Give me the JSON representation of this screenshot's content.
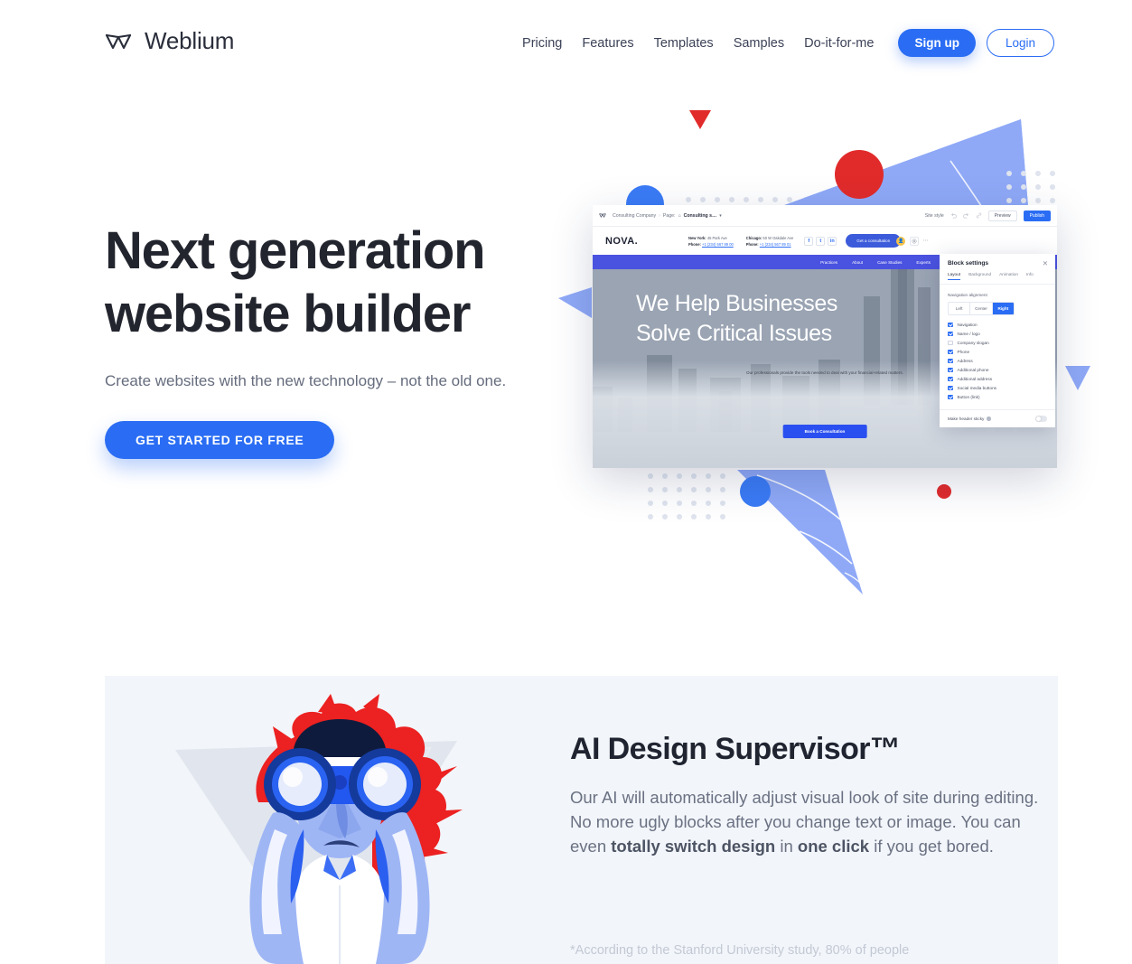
{
  "brand": {
    "name": "Weblium",
    "logo_icon": "weblium-w-logo"
  },
  "nav": {
    "links": [
      "Pricing",
      "Features",
      "Templates",
      "Samples",
      "Do-it-for-me"
    ],
    "signup_label": "Sign up",
    "login_label": "Login"
  },
  "hero": {
    "title_line1": "Next generation",
    "title_line2": "website builder",
    "subtitle": "Create websites with the new technology – not the old one.",
    "cta_label": "GET STARTED FOR FREE"
  },
  "editor": {
    "toolbar": {
      "logo_icon": "weblium-w-logo",
      "crumb_site": "Consulting Company",
      "crumb_sep": "›",
      "crumb_page_label": "Page:",
      "crumb_page_icon": "home-icon",
      "crumb_page_name": "Consulting s…",
      "crumb_caret": "▾",
      "site_style_label": "Site style",
      "undo_icon": "undo-icon",
      "redo_icon": "redo-icon",
      "link_icon": "link-icon",
      "preview_label": "Preview",
      "publish_label": "Publish"
    },
    "site": {
      "logo": "NOVA.",
      "contact1_city": "New York:",
      "contact1_address": "45 Park Ave",
      "contact1_phone_label": "Phone:",
      "contact1_phone": "+1 (234) 567 89 00",
      "contact2_city": "Chicago:",
      "contact2_address": "50 W Oakdale Ave",
      "contact2_phone_label": "Phone:",
      "contact2_phone": "+1 (234) 567 89 01",
      "social_facebook": "f",
      "social_twitter": "t",
      "social_linkedin": "in",
      "consult_button": "Get a consultation",
      "avatar_icon": "user-avatar-icon",
      "settings_icon": "gear-icon",
      "more_icon": "more-dots-icon",
      "menu": [
        "Practices",
        "About",
        "Case Studies",
        "Experts"
      ],
      "hero_title_line1": "We Help Businesses",
      "hero_title_line2": "Solve Critical Issues",
      "hero_sub": "Our professionals provide the tools needed to deal with your financial-related matters.",
      "hero_button": "Book a Consultation"
    },
    "panel": {
      "title": "Block settings",
      "close_icon": "close-icon",
      "tabs": [
        "Layout",
        "Background",
        "Animation",
        "Info"
      ],
      "active_tab": "Layout",
      "alignment_label": "Navigation alignment",
      "alignment_options": [
        "Left",
        "Center",
        "Right"
      ],
      "alignment_selected": "Right",
      "checkboxes": [
        {
          "label": "Navigation",
          "checked": true
        },
        {
          "label": "Name / logo",
          "checked": true
        },
        {
          "label": "Company slogan",
          "checked": false
        },
        {
          "label": "Phone",
          "checked": true
        },
        {
          "label": "Address",
          "checked": true
        },
        {
          "label": "Additional phone",
          "checked": true
        },
        {
          "label": "Additional address",
          "checked": true
        },
        {
          "label": "Social media buttons",
          "checked": true
        },
        {
          "label": "Button (link)",
          "checked": true
        }
      ],
      "sticky_label": "Make header sticky",
      "sticky_info_icon": "info-icon",
      "sticky_enabled": false
    }
  },
  "feature": {
    "title": "AI Design Supervisor™",
    "body_1": "Our AI will automatically adjust visual look of site during editing. No more ugly blocks after you change text or image. You can even ",
    "body_bold_1": "totally switch design",
    "body_2": " in ",
    "body_bold_2": "one click",
    "body_3": " if you get bored.",
    "note": "*According to the Stanford University study, 80% of people",
    "illustration": "person-with-binoculars-illustration"
  },
  "colors": {
    "accent_blue": "#2a6df4",
    "red": "#e12b2b",
    "light_blue": "#8fa9f7",
    "section_bg": "#f2f5fa",
    "heading": "#22252e"
  }
}
